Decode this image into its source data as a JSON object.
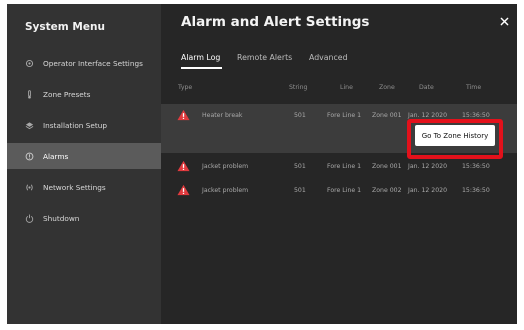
{
  "sidebar": {
    "title": "System Menu",
    "items": [
      {
        "label": "Operator Interface Settings",
        "icon": "gear-icon"
      },
      {
        "label": "Zone Presets",
        "icon": "thermometer-icon"
      },
      {
        "label": "Installation Setup",
        "icon": "layers-icon"
      },
      {
        "label": "Alarms",
        "icon": "alarm-icon"
      },
      {
        "label": "Network Settings",
        "icon": "network-icon"
      },
      {
        "label": "Shutdown",
        "icon": "power-icon"
      }
    ],
    "active_item": "Alarms"
  },
  "header": {
    "title": "Alarm and Alert Settings",
    "close_icon": "close-icon"
  },
  "tabs": [
    {
      "label": "Alarm Log"
    },
    {
      "label": "Remote Alerts"
    },
    {
      "label": "Advanced"
    }
  ],
  "active_tab": "Alarm Log",
  "table": {
    "columns": [
      "Type",
      "String",
      "Line",
      "Zone",
      "Date",
      "Time"
    ],
    "rows": [
      {
        "type": "Heater break",
        "string": "501",
        "line": "Fore Line 1",
        "zone": "Zone 001",
        "date": "Jan. 12 2020",
        "time": "15:36:50"
      },
      {
        "type": "Jacket problem",
        "string": "501",
        "line": "Fore Line 1",
        "zone": "Zone 001",
        "date": "Jan. 12 2020",
        "time": "15:36:50"
      },
      {
        "type": "Jacket problem",
        "string": "501",
        "line": "Fore Line 1",
        "zone": "Zone 002",
        "date": "Jan. 12 2020",
        "time": "15:36:50"
      }
    ]
  },
  "popup": {
    "button_label": "Go To Zone History"
  },
  "colors": {
    "warning": "#e03a3e",
    "highlight": "#e3111b"
  }
}
